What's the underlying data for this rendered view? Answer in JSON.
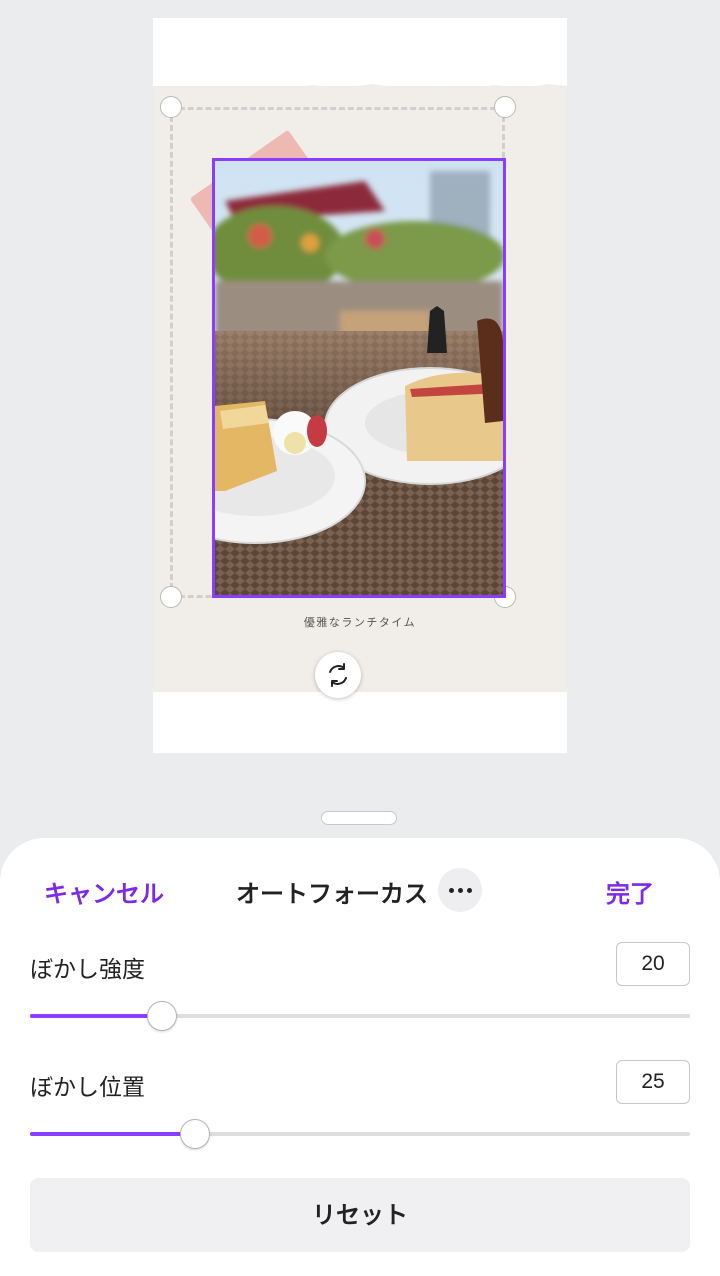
{
  "design": {
    "caption": "優雅なランチタイム"
  },
  "panel": {
    "cancel_label": "キャンセル",
    "title": "オートフォーカス",
    "done_label": "完了",
    "more_icon": "more-horizontal-icon",
    "accent_color": "#7d2ae8",
    "blur_strength": {
      "label": "ぼかし強度",
      "value": "20",
      "fraction": 0.2
    },
    "blur_position": {
      "label": "ぼかし位置",
      "value": "25",
      "fraction": 0.25
    },
    "reset_label": "リセット"
  }
}
